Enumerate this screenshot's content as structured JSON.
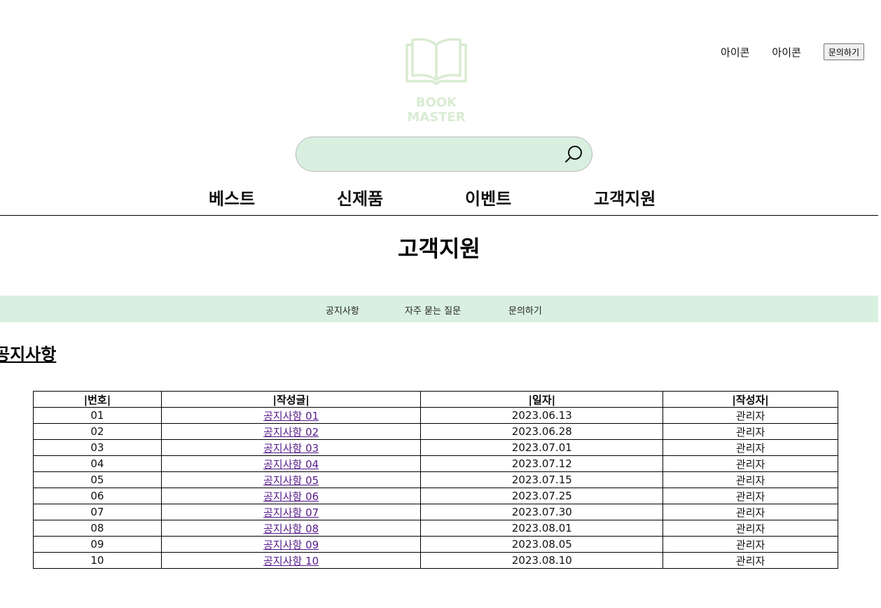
{
  "header": {
    "logo_text": "BOOK MASTER",
    "top_links": [
      "아이콘",
      "아이콘"
    ],
    "inquiry_button": "문의하기",
    "brand_color": "#d9ecd3"
  },
  "search": {
    "placeholder": "",
    "value": "",
    "background": "#d9f0e0"
  },
  "nav": {
    "items": [
      "베스트",
      "신제품",
      "이벤트",
      "고객지원"
    ]
  },
  "page_title": "고객지원",
  "sub_nav": {
    "items": [
      "공지사항",
      "자주 묻는 질문",
      "문의하기"
    ]
  },
  "section_title": "공지사항",
  "notice_table": {
    "headers": [
      "|번호|",
      "|작성글|",
      "|일자|",
      "|작성자|"
    ],
    "rows": [
      {
        "no": "01",
        "title": "공지사항 01",
        "date": "2023.06.13",
        "writer": "관리자"
      },
      {
        "no": "02",
        "title": "공지사항 02",
        "date": "2023.06.28",
        "writer": "관리자"
      },
      {
        "no": "03",
        "title": "공지사항 03",
        "date": "2023.07.01",
        "writer": "관리자"
      },
      {
        "no": "04",
        "title": "공지사항 04",
        "date": "2023.07.12",
        "writer": "관리자"
      },
      {
        "no": "05",
        "title": "공지사항 05",
        "date": "2023.07.15",
        "writer": "관리자"
      },
      {
        "no": "06",
        "title": "공지사항 06",
        "date": "2023.07.25",
        "writer": "관리자"
      },
      {
        "no": "07",
        "title": "공지사항 07",
        "date": "2023.07.30",
        "writer": "관리자"
      },
      {
        "no": "08",
        "title": "공지사항 08",
        "date": "2023.08.01",
        "writer": "관리자"
      },
      {
        "no": "09",
        "title": "공지사항 09",
        "date": "2023.08.05",
        "writer": "관리자"
      },
      {
        "no": "10",
        "title": "공지사항 10",
        "date": "2023.08.10",
        "writer": "관리자"
      }
    ]
  },
  "icons": {
    "logo": "open-book-icon",
    "search": "search-icon"
  },
  "colors": {
    "link_visited": "#551a8b",
    "accent": "#d9f0e0"
  }
}
